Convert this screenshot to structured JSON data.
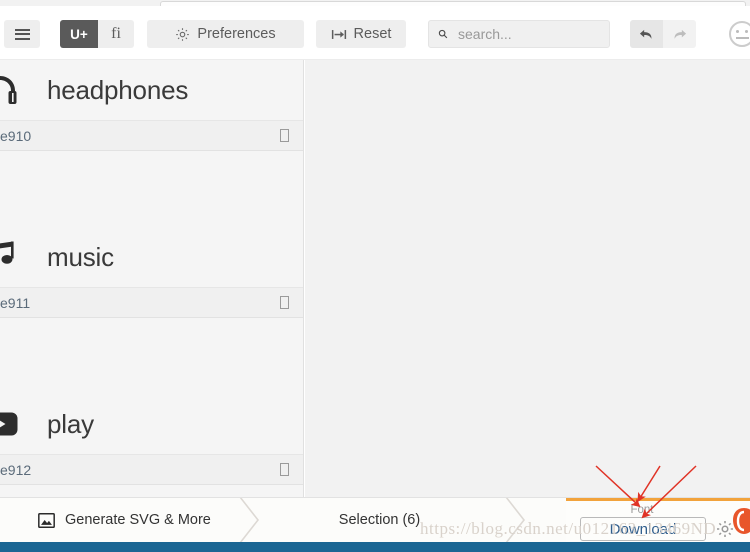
{
  "app": {
    "name": "IcoMoon App",
    "accent_orange": "#f2a33c",
    "panel_bg": "#f5f5f5",
    "workspace_bg": "#f2f2f2",
    "bottom_strip_color": "#1b6693"
  },
  "toolbar": {
    "menu_icon": "hamburger-icon",
    "uplus_label": "U+",
    "uplus_icon": "unicode-icon",
    "ligature_label": "fi",
    "ligature_icon": "ligature-icon",
    "preferences_label": "Preferences",
    "preferences_icon": "gear-icon",
    "reset_label": "Reset",
    "reset_icon": "reset-icon",
    "undo_icon": "undo-arrow-icon",
    "redo_icon": "redo-arrow-icon",
    "face_icon": "icomoon-face-icon"
  },
  "search": {
    "icon": "search-icon",
    "value": "",
    "placeholder": "search..."
  },
  "icon_grid": {
    "items": [
      {
        "glyph": "headphones-icon",
        "name": "headphones",
        "code": "e910",
        "preview": "tofu-box"
      },
      {
        "glyph": "music-note-icon",
        "name": "music",
        "code": "e911",
        "preview": "tofu-box"
      },
      {
        "glyph": "play-video-icon",
        "name": "play",
        "code": "e912",
        "preview": "tofu-box"
      }
    ]
  },
  "bottom_bar": {
    "generate_label": "Generate SVG & More",
    "generate_icon": "image-icon",
    "selection_label": "Selection (6)",
    "font_tab_label": "Font",
    "download_label": "Download",
    "download_gear_icon": "gear-icon",
    "icomoon_logo_icon": "icomoon-logo-icon"
  },
  "watermark": {
    "text": "https://blog.csdn.net/u012163_13469ND"
  },
  "annotations": {
    "arrow_color": "#e03326",
    "arrow_count": 3,
    "targets": [
      "font-tab",
      "download-button",
      "download-button"
    ]
  }
}
